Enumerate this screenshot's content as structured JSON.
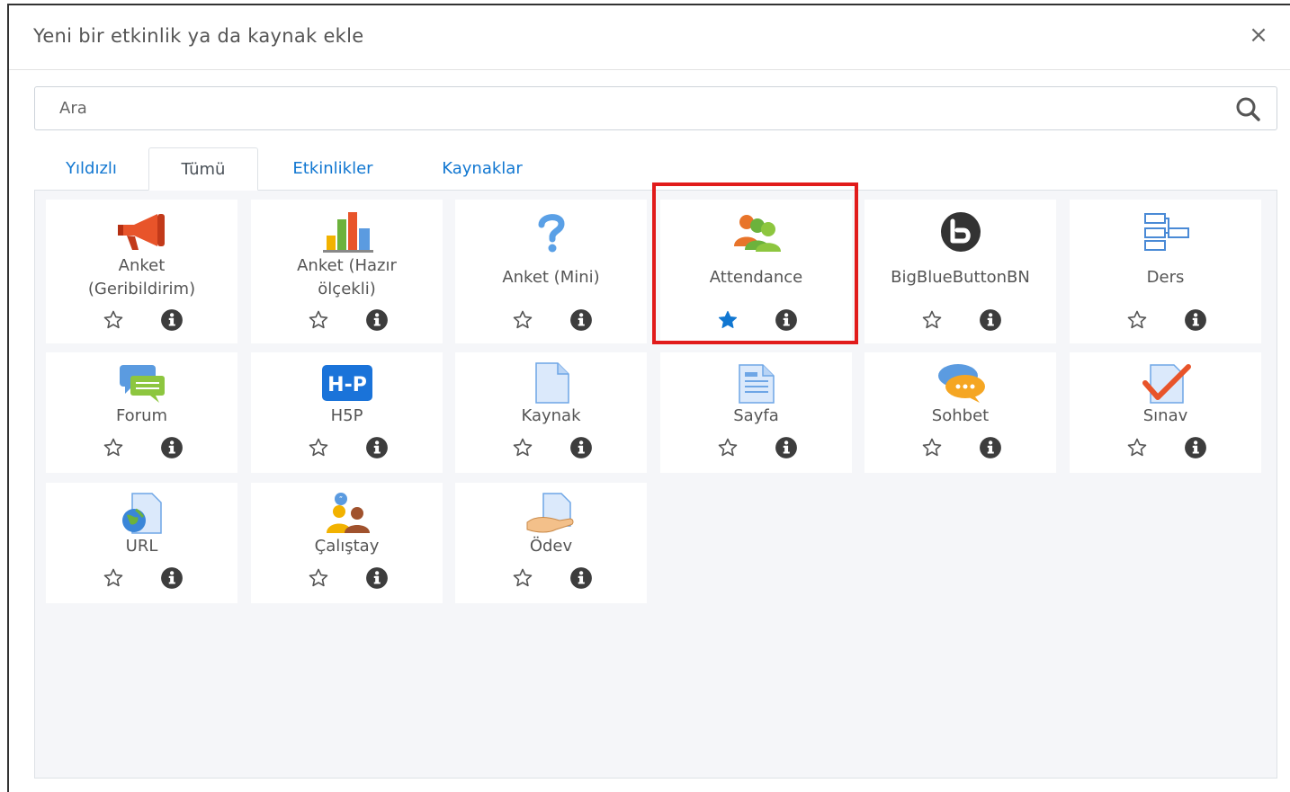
{
  "dialog": {
    "title": "Yeni bir etkinlik ya da kaynak ekle",
    "close_symbol": "×"
  },
  "search": {
    "placeholder": "Ara"
  },
  "tabs": [
    {
      "label": "Yıldızlı",
      "active": false
    },
    {
      "label": "Tümü",
      "active": true
    },
    {
      "label": "Etkinlikler",
      "active": false
    },
    {
      "label": "Kaynaklar",
      "active": false
    }
  ],
  "modules": [
    {
      "label": "Anket (Geribildirim)",
      "icon": "megaphone-icon",
      "starred": false
    },
    {
      "label": "Anket (Hazır ölçekli)",
      "icon": "bar-chart-icon",
      "starred": false
    },
    {
      "label": "Anket (Mini)",
      "icon": "question-mark-icon",
      "starred": false
    },
    {
      "label": "Attendance",
      "icon": "people-group-icon",
      "starred": true,
      "highlighted": true
    },
    {
      "label": "BigBlueButtonBN",
      "icon": "bigbluebutton-icon",
      "starred": false
    },
    {
      "label": "Ders",
      "icon": "lesson-flow-icon",
      "starred": false
    },
    {
      "label": "Forum",
      "icon": "forum-bubbles-icon",
      "starred": false
    },
    {
      "label": "H5P",
      "icon": "h5p-icon",
      "starred": false
    },
    {
      "label": "Kaynak",
      "icon": "file-icon",
      "starred": false
    },
    {
      "label": "Sayfa",
      "icon": "page-icon",
      "starred": false
    },
    {
      "label": "Sohbet",
      "icon": "chat-bubbles-icon",
      "starred": false
    },
    {
      "label": "Sınav",
      "icon": "quiz-check-icon",
      "starred": false
    },
    {
      "label": "URL",
      "icon": "url-globe-icon",
      "starred": false
    },
    {
      "label": "Çalıştay",
      "icon": "workshop-people-icon",
      "starred": false
    },
    {
      "label": "Ödev",
      "icon": "assignment-hand-icon",
      "starred": false
    }
  ],
  "colors": {
    "link": "#1177d1",
    "star_active": "#1177d1",
    "highlight_border": "#e11b1b",
    "content_bg": "#f5f6f9"
  }
}
